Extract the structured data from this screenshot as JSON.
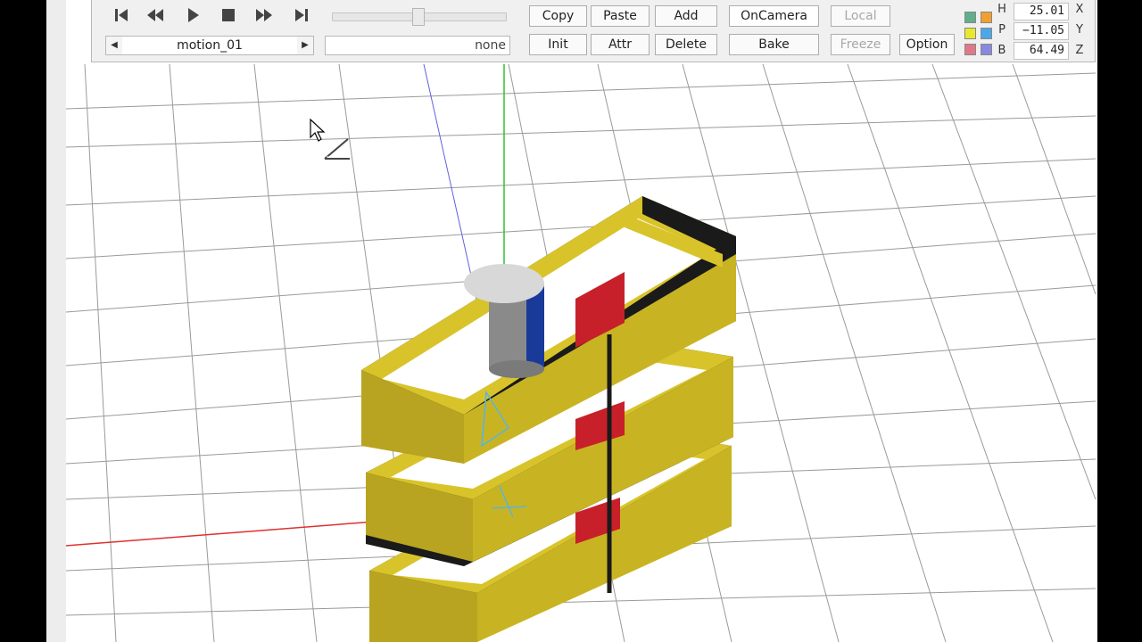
{
  "playback": {
    "first_icon": "skip-to-start-icon",
    "rewind_icon": "rewind-icon",
    "play_icon": "play-icon",
    "stop_icon": "stop-icon",
    "forward_icon": "fast-forward-icon",
    "last_icon": "skip-to-end-icon",
    "timeline_slider_value": 0.5
  },
  "motion": {
    "prev_icon": "prev-arrow-icon",
    "next_icon": "next-arrow-icon",
    "name": "motion_01",
    "field_value": "none"
  },
  "buttons": {
    "copy": "Copy",
    "paste": "Paste",
    "add": "Add",
    "oncamera": "OnCamera",
    "local": "Local",
    "init": "Init",
    "attr": "Attr",
    "delete": "Delete",
    "bake": "Bake",
    "freeze": "Freeze",
    "option": "Option"
  },
  "color_swatches": [
    "#5fb08a",
    "#f0a030",
    "#e8e830",
    "#4aa8e8",
    "#e07888",
    "#8888e0"
  ],
  "orientation": {
    "h_label": "H",
    "h_value": "25.01",
    "p_label": "P",
    "p_value": "−11.05",
    "b_label": "B",
    "b_value": "64.49"
  },
  "axes": {
    "x_label": "X",
    "y_label": "Y",
    "z_label": "Z"
  },
  "colors": {
    "model_yellow": "#d8c42a",
    "model_red": "#c8202a",
    "axis_x": "#e03030",
    "axis_y": "#30c030",
    "axis_z": "#6060e0"
  }
}
